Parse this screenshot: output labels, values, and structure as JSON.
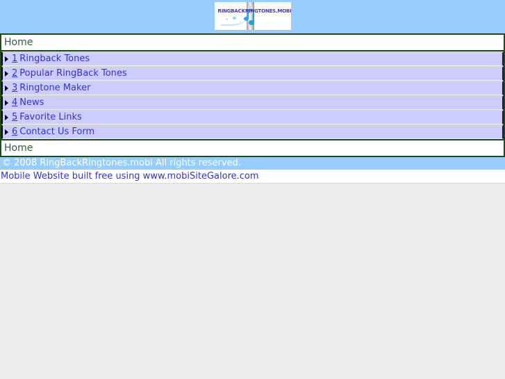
{
  "banner": {
    "logo_alt": "RINGBACKRINGTONES.MOBI logo",
    "logo_text": "RINGBACKRINGTONES.MOBI",
    "background_color": "#99ccff"
  },
  "header_bar": {
    "label": "Home"
  },
  "menu": {
    "items": [
      {
        "number": "1",
        "label": "Ringback Tones"
      },
      {
        "number": "2",
        "label": "Popular RingBack Tones"
      },
      {
        "number": "3",
        "label": "Ringtone Maker"
      },
      {
        "number": "4",
        "label": "News"
      },
      {
        "number": "5",
        "label": "Favorite Links"
      },
      {
        "number": "6",
        "label": "Contact Us Form"
      }
    ],
    "bullet_icon": "triangle-right-icon",
    "item_background": "#ccccff",
    "link_color": "#3333cc"
  },
  "footer_bar": {
    "label": "Home"
  },
  "footer": {
    "copyright": "© 2008 RingBackRingtones.mobi All rights reserved.",
    "built_with": "Mobile Website built free using www.mobiSiteGalore.com",
    "copyright_background": "#99ccff",
    "copyright_color": "#ffffff"
  },
  "page": {
    "background_color": "#ededed",
    "border_color": "#1b4d1b"
  }
}
